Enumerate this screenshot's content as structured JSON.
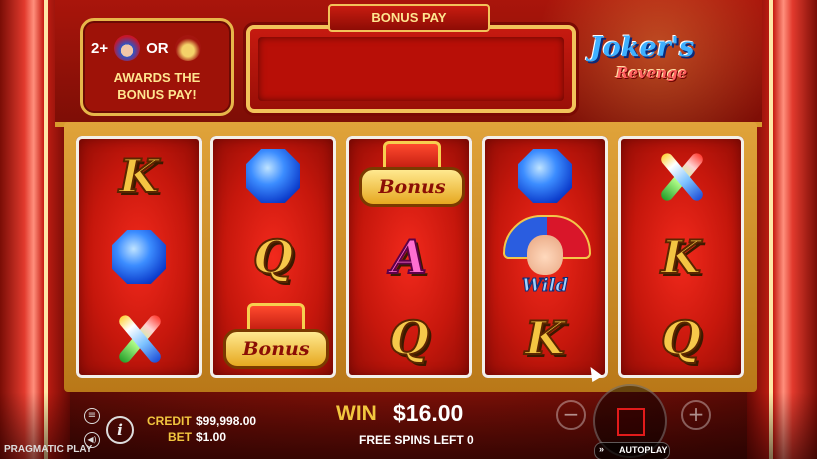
{
  "game": {
    "logo_line1": "Joker's",
    "logo_line2": "Revenge"
  },
  "award_box": {
    "count": "2+",
    "or_label": "OR",
    "line1": "AWARDS THE",
    "line2": "BONUS PAY!",
    "mini_bonus_label": "Bonus"
  },
  "bonus_pay": {
    "label": "BONUS PAY",
    "value": ""
  },
  "reels": [
    [
      "K",
      "gem",
      "pins"
    ],
    [
      "gem",
      "Q",
      "bonus"
    ],
    [
      "bonus",
      "A",
      "Q"
    ],
    [
      "gem",
      "wild",
      "K"
    ],
    [
      "pins",
      "K",
      "Q"
    ]
  ],
  "symbol_labels": {
    "bonus": "Bonus",
    "wild": "Wild"
  },
  "hud": {
    "credit_label": "CREDIT",
    "credit_value": "$99,998.00",
    "bet_label": "BET",
    "bet_value": "$1.00",
    "win_label": "WIN",
    "win_value": "$16.00",
    "free_spins": "FREE SPINS LEFT 0",
    "autoplay_label": "AUTOPLAY",
    "autoplay_icon": "»",
    "minus": "−",
    "plus": "+",
    "info_icon": "i",
    "menu_icon": "≡",
    "sound_icon": "◀)"
  },
  "brand": "PRAGMATIC PLAY",
  "colors": {
    "gold": "#f2c63f",
    "reel_red": "#d11a0e",
    "frame_gold": "#e0a33a"
  },
  "icons": {
    "menu": "menu-icon",
    "info": "info-icon",
    "sound": "sound-icon",
    "spin": "spin-icon",
    "autoplay": "autoplay-icon"
  }
}
